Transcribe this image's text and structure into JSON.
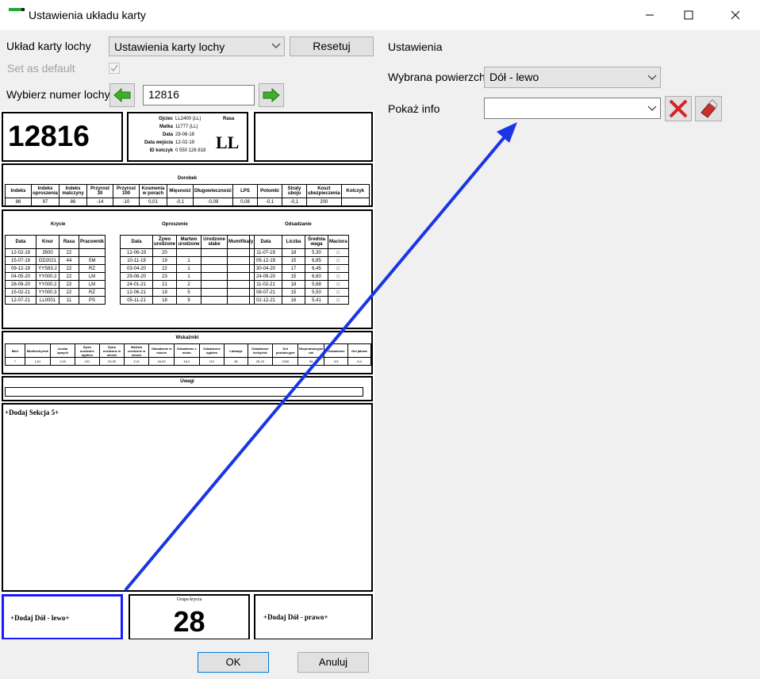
{
  "window": {
    "title": "Ustawienia układu karty",
    "accent": "#22a83a"
  },
  "left": {
    "layout_label": "Układ karty lochy",
    "layout_value": "Ustawienia karty lochy",
    "reset_label": "Resetuj",
    "default_label": "Set as default",
    "number_label": "Wybierz numer lochy",
    "number_value": "12816"
  },
  "right": {
    "settings_heading": "Ustawienia",
    "surface_label": "Wybrana powierzchn",
    "surface_value": "Dół - lewo",
    "info_label": "Pokaż info",
    "info_value": ""
  },
  "card": {
    "sow_number": "12816",
    "meta": [
      [
        "Ojciec",
        "LL2400 (LL)"
      ],
      [
        "Matka",
        "11777 (LL)"
      ],
      [
        "Data",
        "29-06-18"
      ],
      [
        "Data wejścia",
        "12-02-19"
      ],
      [
        "ID kolczyk",
        "0 550 126 818"
      ]
    ],
    "race_label": "Rasa",
    "race_value": "LL",
    "stats_title": "Dorobek",
    "stats_headers": [
      "Indeks",
      "Indeks oproszenia",
      "Indeks matczyny",
      "Przyrost 30",
      "Przyrost 100",
      "Kosmenia w porach",
      "Mięsność",
      "Długowieczność",
      "LPS",
      "Potomki",
      "Straty uboju",
      "Koszt ubezpieczenia",
      "Kolczyk"
    ],
    "stats_values": [
      "86",
      "97",
      "86",
      "-14",
      "-10",
      "0,01",
      "-0,1",
      "-0,09",
      "0,08",
      "-0,1",
      "-0,1",
      "200",
      ""
    ],
    "krycie_title": "Krycie",
    "krycie_headers": [
      "Data",
      "Knur",
      "Rasa",
      "Pracownik"
    ],
    "krycie_rows": [
      [
        "12-02-19",
        "3500",
        "22",
        ""
      ],
      [
        "15-07-19",
        "DD2021",
        "44",
        "SM"
      ],
      [
        "09-12-19",
        "YYS83.2",
        "22",
        "RZ"
      ],
      [
        "04-05-20",
        "YY000.2",
        "22",
        "LM"
      ],
      [
        "28-09-20",
        "YY000.2",
        "22",
        "LM"
      ],
      [
        "15-02-21",
        "YY000.3",
        "22",
        "RZ"
      ],
      [
        "12-07-21",
        "LL0001",
        "11",
        "PS"
      ]
    ],
    "oproszenie_title": "Oproszenie",
    "oproszenie_headers": [
      "Data",
      "Żywo urodzone",
      "Martwo urodzone",
      "Urodzone słabe",
      "Mumifikaty"
    ],
    "oproszenie_rows": [
      [
        "12-06-19",
        "20",
        "",
        "",
        ""
      ],
      [
        "10-11-19",
        "19",
        "1",
        "",
        ""
      ],
      [
        "03-04-20",
        "22",
        "1",
        "",
        ""
      ],
      [
        "29-08-20",
        "23",
        "1",
        "",
        ""
      ],
      [
        "24-01-21",
        "21",
        "2",
        "",
        ""
      ],
      [
        "12-06-21",
        "19",
        "5",
        "",
        ""
      ],
      [
        "05-11-21",
        "18",
        "9",
        "",
        ""
      ]
    ],
    "odsadzanie_title": "Odsadzanie",
    "odsadzanie_headers": [
      "Data",
      "Liczba",
      "Średnia waga",
      "Maciora"
    ],
    "odsadzanie_rows": [
      [
        "11-07-19",
        "18",
        "5,30"
      ],
      [
        "05-12-19",
        "15",
        "6,85"
      ],
      [
        "30-04-20",
        "17",
        "6,45"
      ],
      [
        "24-09-20",
        "15",
        "6,60"
      ],
      [
        "11-02-21",
        "18",
        "5,68"
      ],
      [
        "08-07-21",
        "15",
        "5,50"
      ],
      [
        "02-12-21",
        "16",
        "5,41"
      ]
    ],
    "wskazniki_title": "Wskaźniki",
    "wskazniki_headers": [
      "Miot",
      "Miot/lochy/rok",
      "Liczba żywych",
      "Żywo urodzone ogółem",
      "Żywo urodzone w miocie",
      "Martwo urodzone w miocie",
      "Odsadzone w miocie",
      "Odsadzone z miotu",
      "Odsadzone ogółem",
      "Laktacja",
      "Odsadzone lochy/rok",
      "Dni produkcyjne",
      "Nieprodukcyjne dni",
      "Odsadzone",
      "Dni jałowe"
    ],
    "wskazniki_values": [
      "7",
      "1,61",
      "1,00",
      "101",
      "20,39",
      "3,11",
      "16,00",
      "16,0",
      "112",
      "36",
      "26,15",
      "1000",
      "56",
      "111",
      "8,4"
    ],
    "uwagi_title": "Uwagi",
    "section5_label": "+Dodaj Sekcja 5+",
    "bottom_left_label": "+Dodaj Dół - lewo+",
    "group_label": "Grupa krycia",
    "group_value": "28",
    "bottom_right_label": "+Dodaj Dół - prawo+"
  },
  "footer": {
    "ok_label": "OK",
    "cancel_label": "Anuluj"
  },
  "colors": {
    "highlight": "#1a1aff",
    "arrow": "#1a35e6",
    "delete_red": "#d92020",
    "nav_green": "#3fae2b"
  }
}
